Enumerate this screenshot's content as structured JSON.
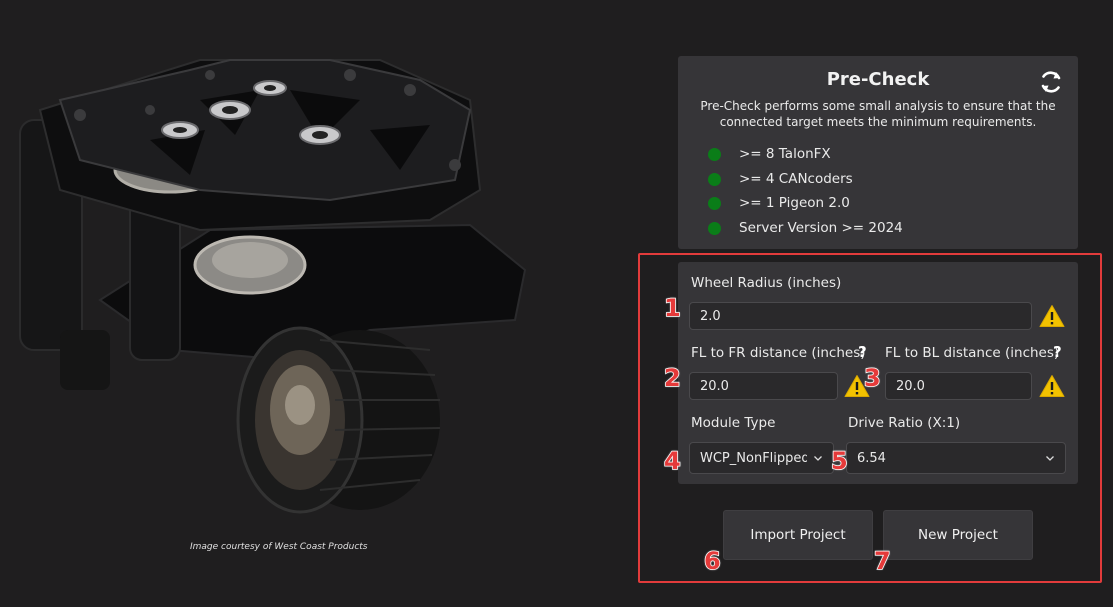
{
  "caption": "Image courtesy of West Coast Products",
  "precheck": {
    "title": "Pre-Check",
    "description": "Pre-Check performs some small analysis to ensure that the connected target meets the minimum requirements.",
    "refresh_icon": "refresh-icon",
    "requirements": [
      {
        "label": ">= 8 TalonFX",
        "status": "pass",
        "color": "#0a7d18"
      },
      {
        "label": ">= 4 CANcoders",
        "status": "pass",
        "color": "#0a7d18"
      },
      {
        "label": ">= 1 Pigeon 2.0",
        "status": "pass",
        "color": "#0a7d18"
      },
      {
        "label": "Server Version >= 2024",
        "status": "pass",
        "color": "#0a7d18"
      }
    ]
  },
  "form": {
    "wheel_radius": {
      "label": "Wheel Radius (inches)",
      "value": "2.0"
    },
    "fl_fr": {
      "label": "FL to FR distance (inches)",
      "value": "20.0",
      "help": "?"
    },
    "fl_bl": {
      "label": "FL to BL distance (inches)",
      "value": "20.0",
      "help": "?"
    },
    "module_type": {
      "label": "Module Type",
      "value": "WCP_NonFlipped"
    },
    "drive_ratio": {
      "label": "Drive Ratio (X:1)",
      "value": "6.54"
    }
  },
  "buttons": {
    "import": "Import Project",
    "new": "New Project"
  },
  "annotations": [
    "1",
    "2",
    "3",
    "4",
    "5",
    "6",
    "7"
  ],
  "colors": {
    "background": "#1f1e1f",
    "panel": "#363538",
    "status_ok": "#0a7d18",
    "highlight": "#e23b3b",
    "warning": "#f2c200"
  }
}
